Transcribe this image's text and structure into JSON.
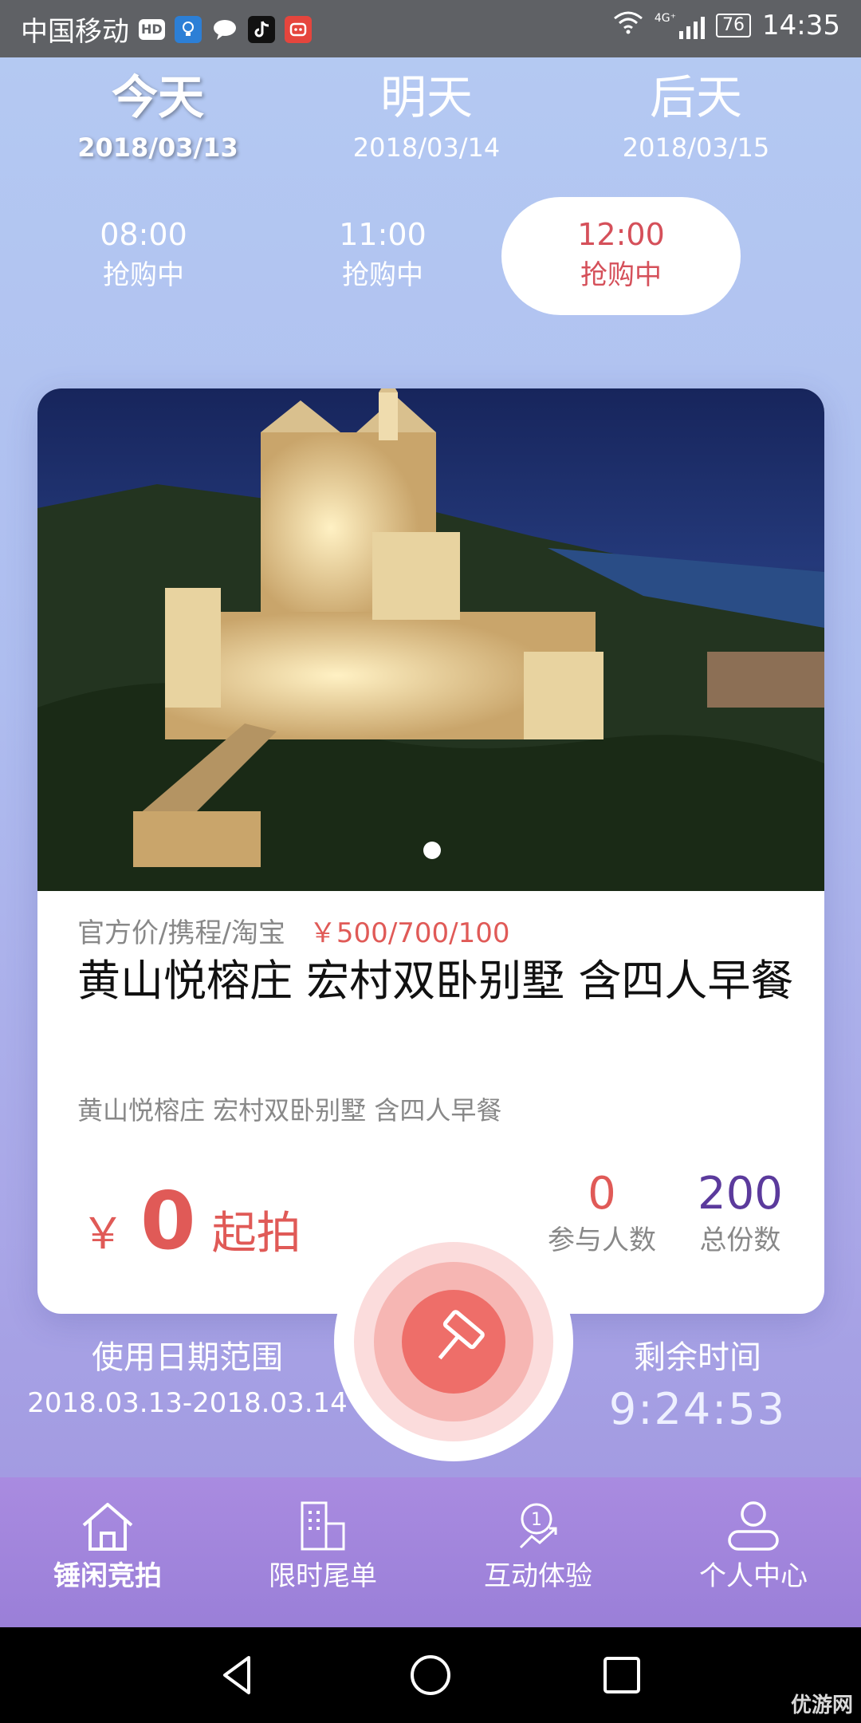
{
  "status_bar": {
    "carrier": "中国移动",
    "network": "4G⁺",
    "battery": "76",
    "time": "14:35",
    "hd_label": "HD"
  },
  "days": [
    {
      "name": "今天",
      "date": "2018/03/13",
      "active": true
    },
    {
      "name": "明天",
      "date": "2018/03/14",
      "active": false
    },
    {
      "name": "后天",
      "date": "2018/03/15",
      "active": false
    }
  ],
  "time_slots": [
    {
      "time": "08:00",
      "status": "抢购中",
      "active": false
    },
    {
      "time": "11:00",
      "status": "抢购中",
      "active": false
    },
    {
      "time": "12:00",
      "status": "抢购中",
      "active": true
    }
  ],
  "product": {
    "price_label": "官方价/携程/淘宝",
    "price_value": "￥500/700/100",
    "title": "黄山悦榕庄 宏村双卧别墅 含四人早餐",
    "subtitle": "黄山悦榕庄 宏村双卧别墅 含四人早餐",
    "start_currency": "￥",
    "start_price": "0",
    "start_suffix": "起拍",
    "participants": "0",
    "participants_label": "参与人数",
    "total": "200",
    "total_label": "总份数"
  },
  "usage": {
    "label": "使用日期范围",
    "value": "2018.03.13-2018.03.14"
  },
  "remaining": {
    "label": "剩余时间",
    "value": "9:24:53"
  },
  "tabs": [
    {
      "label": "锤闲竞拍",
      "icon": "home-icon",
      "active": true
    },
    {
      "label": "限时尾单",
      "icon": "building-icon",
      "active": false
    },
    {
      "label": "互动体验",
      "icon": "trend-icon",
      "active": false
    },
    {
      "label": "个人中心",
      "icon": "user-icon",
      "active": false
    }
  ],
  "watermark": "优游网",
  "colors": {
    "accent": "#e05a57",
    "total_color": "#5b3a9c",
    "tabbar": "#a98be0"
  }
}
